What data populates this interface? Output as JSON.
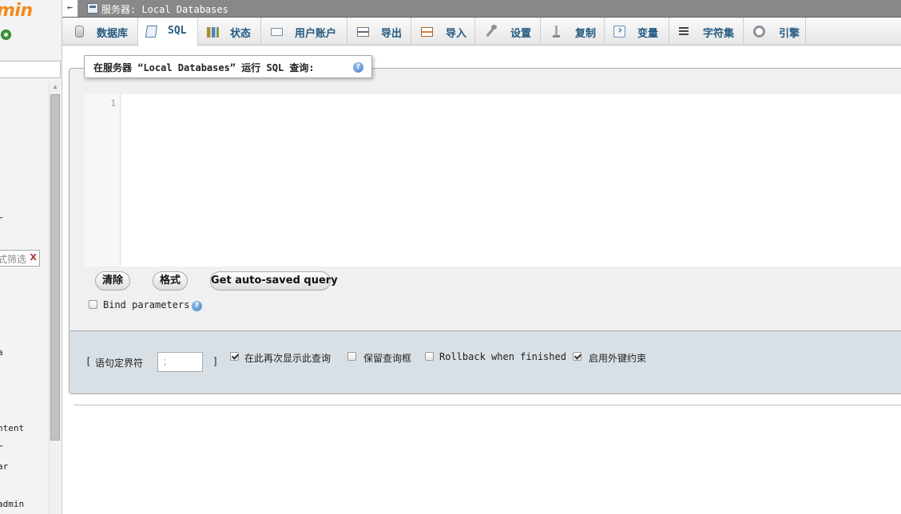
{
  "nav": {
    "logo_fragment": "min",
    "fragments": [
      "r",
      "a",
      "ntent",
      "r",
      "ar",
      "admin"
    ],
    "filter_fragment": "式筛选",
    "filter_clear": "X"
  },
  "topbar": {
    "collapse_arrow": "←",
    "breadcrumb": "服务器: Local Databases"
  },
  "tabs": [
    {
      "label": "数据库",
      "icon": "database-icon",
      "active": false
    },
    {
      "label": "SQL",
      "icon": "sql-icon",
      "active": true
    },
    {
      "label": "状态",
      "icon": "status-icon",
      "active": false
    },
    {
      "label": "用户账户",
      "icon": "user-accounts-icon",
      "active": false
    },
    {
      "label": "导出",
      "icon": "export-icon",
      "active": false
    },
    {
      "label": "导入",
      "icon": "import-icon",
      "active": false
    },
    {
      "label": "设置",
      "icon": "wrench-icon",
      "active": false
    },
    {
      "label": "复制",
      "icon": "replication-icon",
      "active": false
    },
    {
      "label": "变量",
      "icon": "variables-icon",
      "active": false
    },
    {
      "label": "字符集",
      "icon": "charset-icon",
      "active": false
    },
    {
      "label": "引擎",
      "icon": "engine-icon",
      "active": false
    }
  ],
  "query": {
    "legend": "在服务器 “Local Databases” 运行 SQL 查询:",
    "help": "?",
    "line_number": "1",
    "editor_value": ""
  },
  "buttons": {
    "clear": "清除",
    "format": "格式",
    "autosave": "Get auto-saved query"
  },
  "bind_parameters": {
    "label": "Bind parameters",
    "checked": false
  },
  "options": {
    "delimiter_open": "[",
    "delimiter_label": "语句定界符",
    "delimiter_value": ";",
    "delimiter_close": "]",
    "show_again": {
      "label": "在此再次显示此查询",
      "checked": true
    },
    "retain_box": {
      "label": "保留查询框",
      "checked": false
    },
    "rollback": {
      "label": "Rollback when finished",
      "checked": false
    },
    "foreign_keys": {
      "label": "启用外键约束",
      "checked": true
    }
  }
}
